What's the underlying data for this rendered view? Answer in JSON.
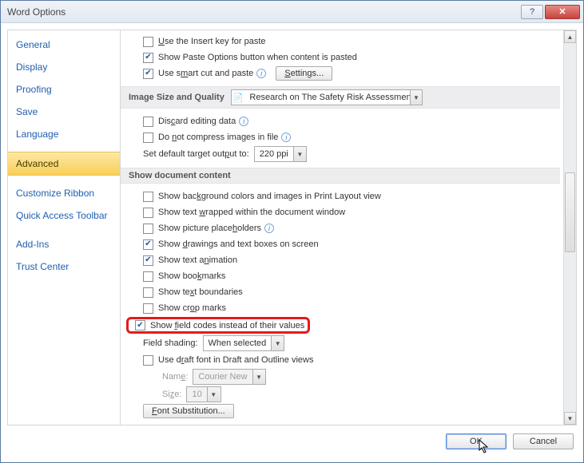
{
  "window": {
    "title": "Word Options"
  },
  "sidebar": {
    "items": [
      {
        "label": "General"
      },
      {
        "label": "Display"
      },
      {
        "label": "Proofing"
      },
      {
        "label": "Save"
      },
      {
        "label": "Language"
      },
      {
        "label": "Advanced",
        "selected": true
      },
      {
        "label": "Customize Ribbon"
      },
      {
        "label": "Quick Access Toolbar"
      },
      {
        "label": "Add-Ins"
      },
      {
        "label": "Trust Center"
      }
    ]
  },
  "cutpaste": {
    "items": [
      {
        "key": "insertkey",
        "label_pre": "",
        "ukey": "U",
        "label_post": "se the Insert key for paste",
        "checked": false
      },
      {
        "key": "pasteoptions",
        "label": "Show Paste Options button when content is pasted",
        "checked": true
      },
      {
        "key": "smartcut",
        "label_pre": "Use s",
        "ukey": "m",
        "label_post": "art cut and paste",
        "checked": true,
        "has_info": true
      }
    ],
    "settings_btn": "Settings..."
  },
  "image_section": {
    "title": "Image Size and Quality",
    "doc_select": "Research on The Safety Risk Assessmen...",
    "items": [
      {
        "key": "discard",
        "label_pre": "Dis",
        "ukey": "c",
        "label_post": "ard editing data",
        "has_info": true,
        "checked": false
      },
      {
        "key": "nocompress",
        "label_pre": "Do ",
        "ukey": "n",
        "label_post": "ot compress images in file",
        "has_info": true,
        "checked": false
      }
    ],
    "target_label_pre": "Set default target out",
    "target_ukey": "p",
    "target_label_post": "ut to:",
    "target_value": "220 ppi"
  },
  "showdoc": {
    "title": "Show document content",
    "items": [
      {
        "key": "bgcolors",
        "pre": "Show bac",
        "u": "k",
        "post": "ground colors and images in Print Layout view",
        "checked": false
      },
      {
        "key": "wrapped",
        "pre": "Show text ",
        "u": "w",
        "post": "rapped within the document window",
        "checked": false
      },
      {
        "key": "picph",
        "pre": "Show picture place",
        "u": "h",
        "post": "olders",
        "checked": false,
        "has_info": true
      },
      {
        "key": "drawings",
        "pre": "Show ",
        "u": "d",
        "post": "rawings and text boxes on screen",
        "checked": true
      },
      {
        "key": "textanim",
        "pre": "Show text a",
        "u": "n",
        "post": "imation",
        "checked": true
      },
      {
        "key": "bookmarks",
        "pre": "Show boo",
        "u": "k",
        "post": "marks",
        "checked": false
      },
      {
        "key": "textbound",
        "pre": "Show te",
        "u": "x",
        "post": "t boundaries",
        "checked": false
      },
      {
        "key": "cropmarks",
        "pre": "Show cr",
        "u": "o",
        "post": "p marks",
        "checked": false
      },
      {
        "key": "fieldcodes",
        "pre": "Show ",
        "u": "f",
        "post": "ield codes instead of their values",
        "checked": true,
        "highlight": true
      }
    ],
    "fieldshading_label": "Field shading:",
    "fieldshading_value": "When selected",
    "draftfont": {
      "pre": "Use d",
      "u": "r",
      "post": "aft font in Draft and Outline views",
      "checked": false
    },
    "name_label_pre": "Nam",
    "name_u": "e",
    "name_post": ":",
    "name_value": "Courier New",
    "size_label_pre": "Si",
    "size_u": "z",
    "size_post": "e:",
    "size_value": "10",
    "font_sub_btn_pre": "",
    "font_sub_u": "F",
    "font_sub_post": "ont Substitution..."
  },
  "footer": {
    "ok": "OK",
    "cancel": "Cancel"
  },
  "colors": {
    "highlight": "#e31b1b"
  }
}
